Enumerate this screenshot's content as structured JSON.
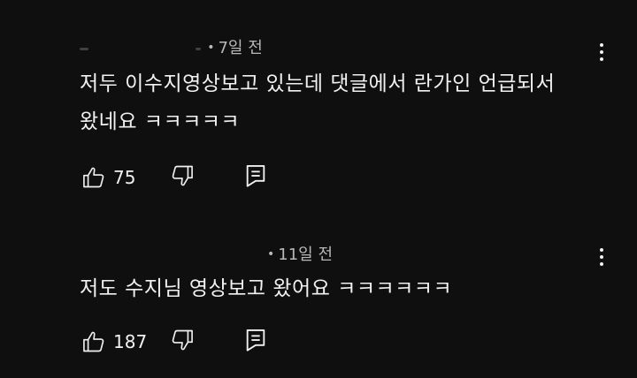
{
  "comments": [
    {
      "time": "7일 전",
      "text_lines": [
        "저두 이수지영상보고 있는데 댓글에서 란가인 언급되서",
        "왔네요 ㅋㅋㅋㅋㅋ"
      ],
      "likes": "75"
    },
    {
      "time": "11일 전",
      "text_lines": [
        "저도 수지님 영상보고 왔어요 ㅋㅋㅋㅋㅋㅋ"
      ],
      "likes": "187"
    }
  ],
  "icons": {
    "like": "thumbs-up-icon",
    "dislike": "thumbs-down-icon",
    "reply": "reply-icon",
    "menu": "more-vert-icon"
  },
  "colors": {
    "background": "#0f0f0f",
    "text": "#f1f1f1",
    "meta": "#aaaaaa"
  }
}
